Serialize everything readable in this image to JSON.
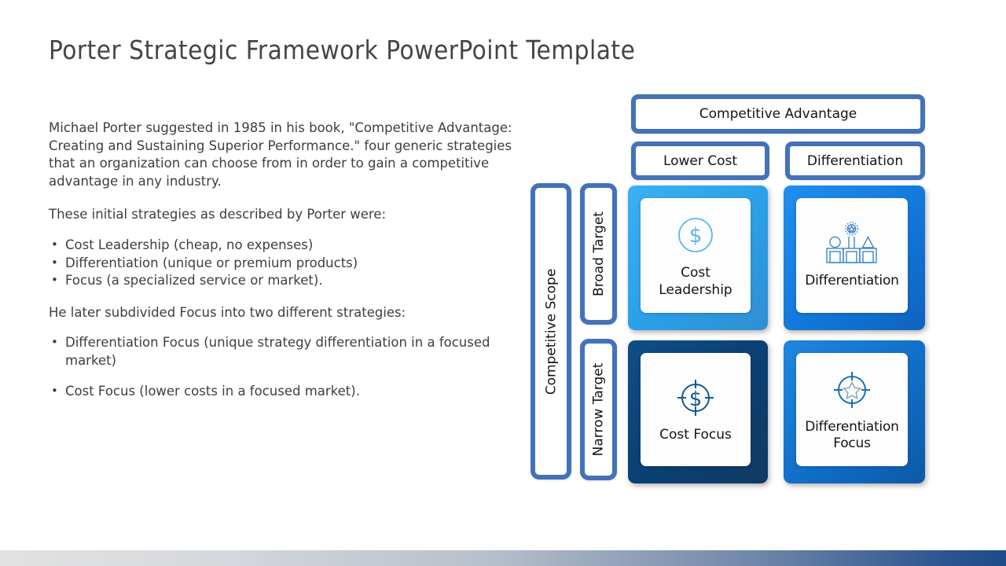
{
  "slide": {
    "title": "Porter Strategic Framework PowerPoint Template"
  },
  "body": {
    "paragraph_1": "Michael Porter suggested in 1985 in his book, \"Competitive Advantage: Creating and Sustaining Superior Performance.\" four generic strategies that an organization can choose from in order to gain a competitive advantage in any industry.",
    "paragraph_2": "These initial strategies as described by Porter were:",
    "strategies": [
      "Cost Leadership (cheap, no expenses)",
      "Differentiation (unique or premium products)",
      "Focus (a specialized service or market)."
    ],
    "paragraph_3": "He later subdivided Focus into two different strategies:",
    "sub_strategies": [
      "Differentiation Focus (unique strategy differentiation in a focused market)",
      "Cost Focus (lower costs in a focused market)."
    ]
  },
  "matrix": {
    "headers": {
      "advantage": "Competitive Advantage",
      "lower_cost": "Lower Cost",
      "differentiation": "Differentiation"
    },
    "scope": {
      "axis": "Competitive Scope",
      "broad": "Broad Target",
      "narrow": "Narrow Target"
    },
    "quadrants": [
      {
        "id": "cost-leadership",
        "label": "Cost\nLeadership",
        "label_line1": "Cost",
        "label_line2": "Leadership",
        "icon": "dollar-circle-icon",
        "frame_color": "#2a9fe8",
        "icon_color": "#5bb4e8"
      },
      {
        "id": "differentiation",
        "label": "Differentiation",
        "icon": "podium-shapes-icon",
        "frame_color": "#1175d8",
        "icon_color": "#2f7fc4"
      },
      {
        "id": "cost-focus",
        "label": "Cost Focus",
        "icon": "dollar-target-icon",
        "frame_color": "#0a3f72",
        "icon_color": "#15588f"
      },
      {
        "id": "differentiation-focus",
        "label": "Differentiation Focus",
        "label_line1": "Differentiation",
        "label_line2": "Focus",
        "icon": "star-target-icon",
        "frame_color": "#0f6cc4",
        "icon_color": "#1b6fb4"
      }
    ]
  },
  "colors": {
    "header_border": "#4472b8",
    "title_text": "#454545",
    "body_text": "#3e3e3e",
    "background": "#ffffff"
  }
}
